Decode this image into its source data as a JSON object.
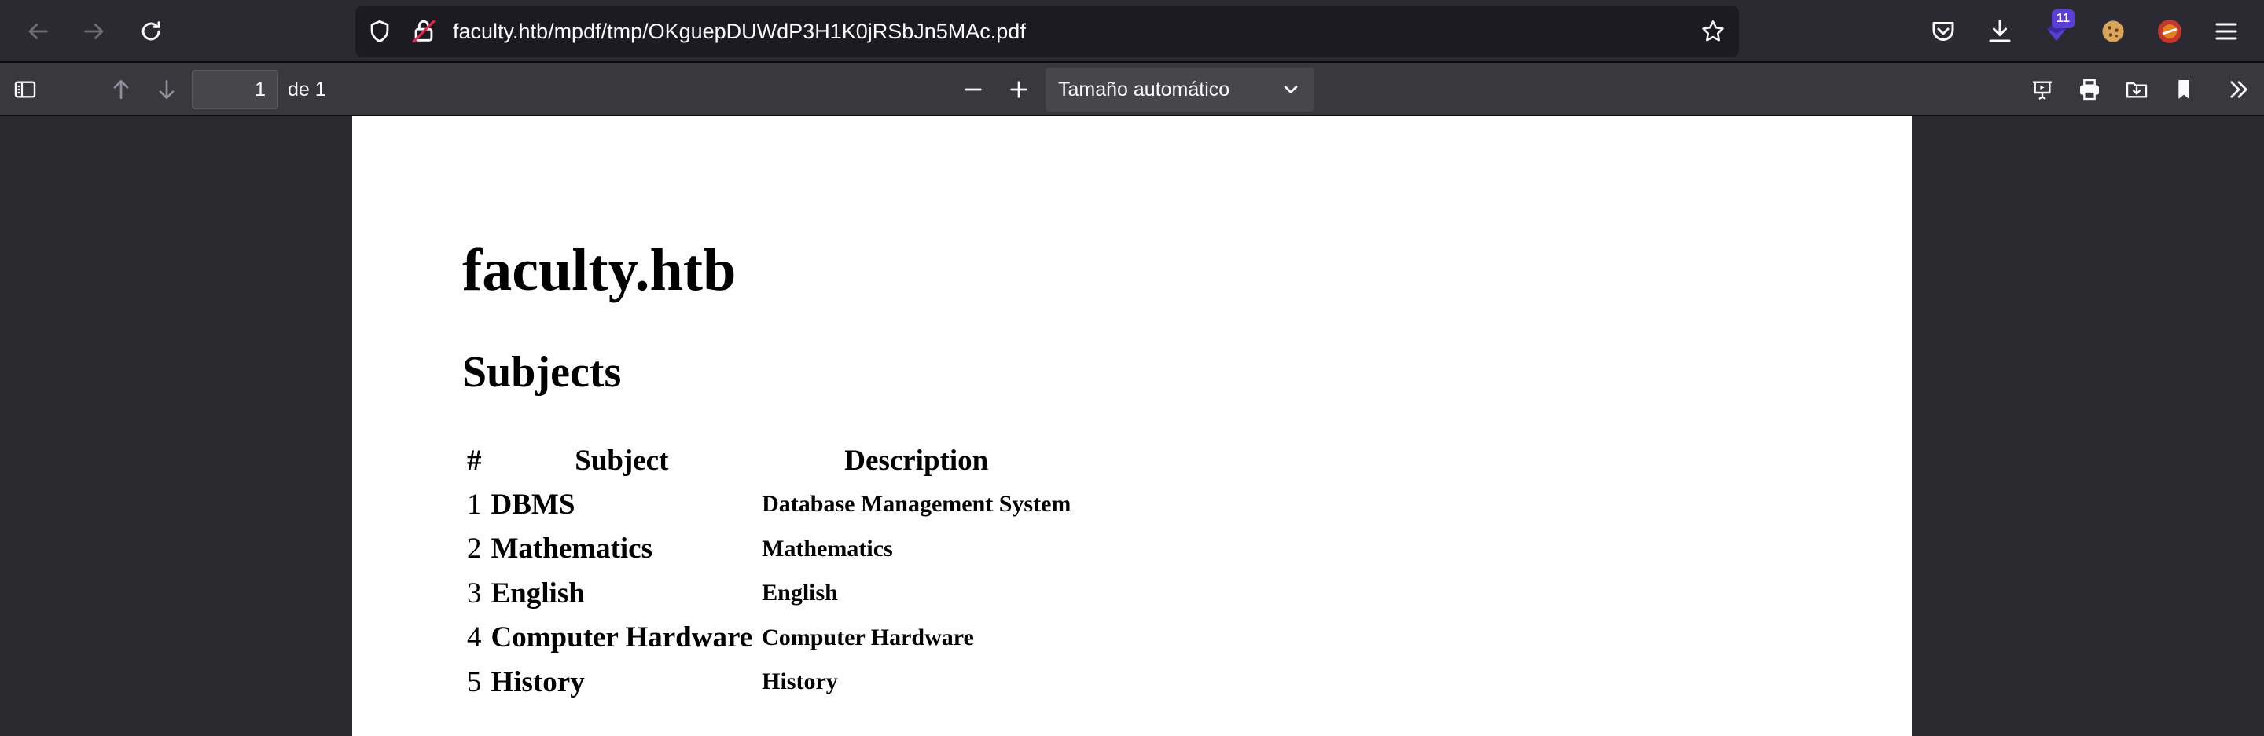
{
  "browser": {
    "url": "faculty.htb/mpdf/tmp/OKguepDUWdP3H1K0jRSbJn5MAc.pdf",
    "extension_badge": "11",
    "icons": {
      "back": "arrow-left-icon",
      "forward": "arrow-right-icon",
      "reload": "reload-icon",
      "tracking_protection": "shield-icon",
      "page_info": "insecure-lock-icon",
      "bookmark": "star-icon",
      "pocket": "pocket-icon",
      "downloads": "download-icon",
      "menu": "hamburger-menu-icon"
    }
  },
  "pdf_toolbar": {
    "page_number": "1",
    "page_count_label": "de 1",
    "zoom_label": "Tamaño automático"
  },
  "document": {
    "title": "faculty.htb",
    "subtitle": "Subjects",
    "table": {
      "headers": [
        "#",
        "Subject",
        "Description"
      ],
      "rows": [
        {
          "num": "1",
          "subject": "DBMS",
          "description": "Database Management System"
        },
        {
          "num": "2",
          "subject": "Mathematics",
          "description": "Mathematics"
        },
        {
          "num": "3",
          "subject": "English",
          "description": "English"
        },
        {
          "num": "4",
          "subject": "Computer Hardware",
          "description": "Computer Hardware"
        },
        {
          "num": "5",
          "subject": "History",
          "description": "History"
        }
      ]
    }
  },
  "colors": {
    "chrome_bg": "#2b2a33",
    "urlbar_bg": "#1c1b22",
    "pdf_toolbar_bg": "#38383d",
    "viewer_bg": "#2a2a2e",
    "page_bg": "#ffffff"
  }
}
